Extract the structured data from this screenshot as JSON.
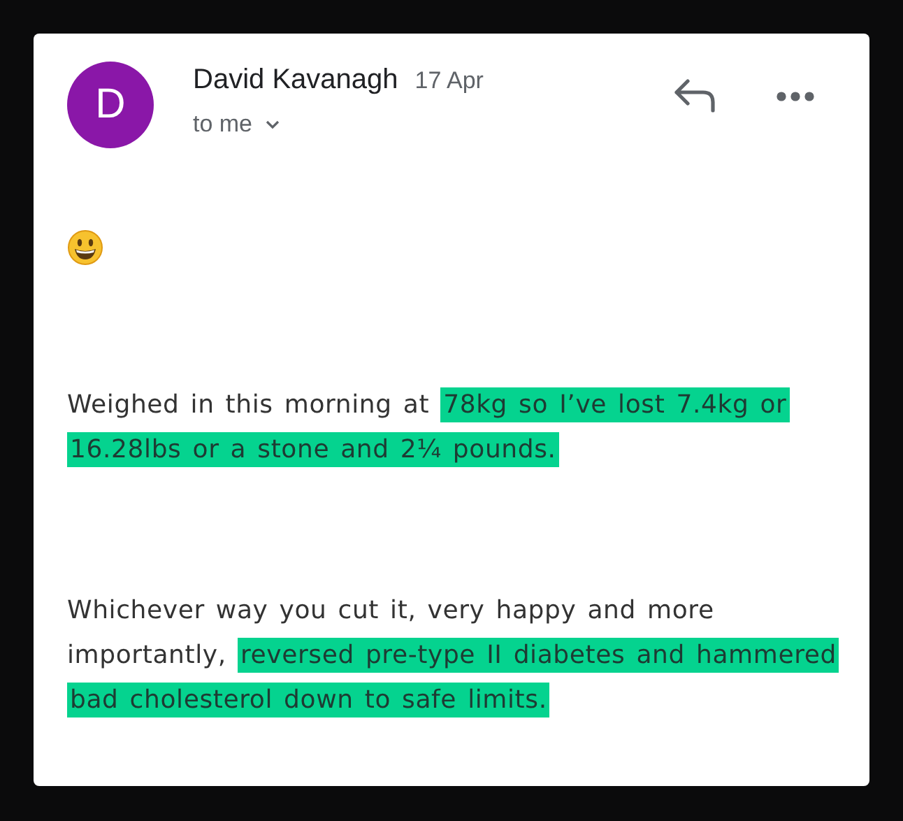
{
  "message": {
    "sender": {
      "initial": "D",
      "color": "#8a17a8",
      "name": "David Kavanagh",
      "date": "17 Apr",
      "recipient": "to me"
    },
    "paragraphs": [
      {
        "segments": [
          {
            "text": "Weighed in this morning at ",
            "highlighted": false
          },
          {
            "text": "78kg so I’ve lost 7.4kg or 16.28lbs or a stone and 2¼ pounds.",
            "highlighted": true
          }
        ]
      },
      {
        "segments": [
          {
            "text": "Whichever way you cut it, very happy and more importantly, ",
            "highlighted": false
          },
          {
            "text": "reversed pre-type II diabetes and hammered bad cholesterol down to safe limits.",
            "highlighted": true
          }
        ]
      }
    ]
  }
}
